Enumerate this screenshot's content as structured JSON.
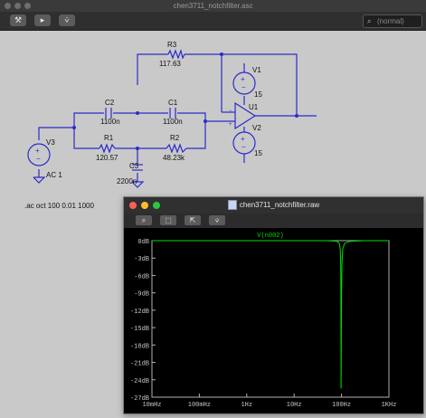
{
  "window": {
    "title": "chen3711_notchfilter.asc"
  },
  "search": {
    "placeholder": "(normal)",
    "icon": "search-icon"
  },
  "toolbar": {
    "icons": [
      "hammer-icon",
      "run-icon",
      "probe-icon"
    ]
  },
  "components": {
    "r3": {
      "name": "R3",
      "value": "117.63"
    },
    "r1": {
      "name": "R1",
      "value": "120.57"
    },
    "r2": {
      "name": "R2",
      "value": "48.23k"
    },
    "c1": {
      "name": "C1",
      "value": "1100n"
    },
    "c2": {
      "name": "C2",
      "value": "1100n"
    },
    "c3": {
      "name": "C3",
      "value": "2200n"
    },
    "v1": {
      "name": "V1",
      "value": "15"
    },
    "v2": {
      "name": "V2",
      "value": "15"
    },
    "v3": {
      "name": "V3",
      "value": "AC 1"
    },
    "u1": {
      "name": "U1"
    }
  },
  "directive": ".ac oct 100 0.01 1000",
  "plot_window": {
    "title": "chen3711_notchfilter.raw",
    "trace_label": "V(n002)",
    "colors": {
      "trace": "#00e000",
      "background": "#000000",
      "frame": "#b0b0b0"
    },
    "x_ticks": [
      "10mHz",
      "100mHz",
      "1Hz",
      "10Hz",
      "100Hz",
      "1KHz"
    ],
    "y_ticks": [
      "0dB",
      "-3dB",
      "-6dB",
      "-9dB",
      "-12dB",
      "-15dB",
      "-18dB",
      "-21dB",
      "-24dB",
      "-27dB"
    ]
  },
  "chart_data": {
    "type": "line",
    "title": "",
    "xlabel": "",
    "ylabel": "",
    "x_scale": "log",
    "xlim": [
      0.01,
      1000
    ],
    "ylim": [
      -27,
      0
    ],
    "series": [
      {
        "name": "V(n002)",
        "x": [
          0.01,
          1,
          10,
          50,
          80,
          90,
          94,
          96,
          97,
          98,
          100,
          102,
          106,
          115,
          150,
          300,
          1000
        ],
        "y": [
          0,
          0,
          0,
          0,
          -0.1,
          -0.5,
          -1.5,
          -4,
          -8,
          -25.5,
          -9,
          -4,
          -1.5,
          -0.5,
          -0.1,
          0,
          0
        ]
      }
    ]
  }
}
